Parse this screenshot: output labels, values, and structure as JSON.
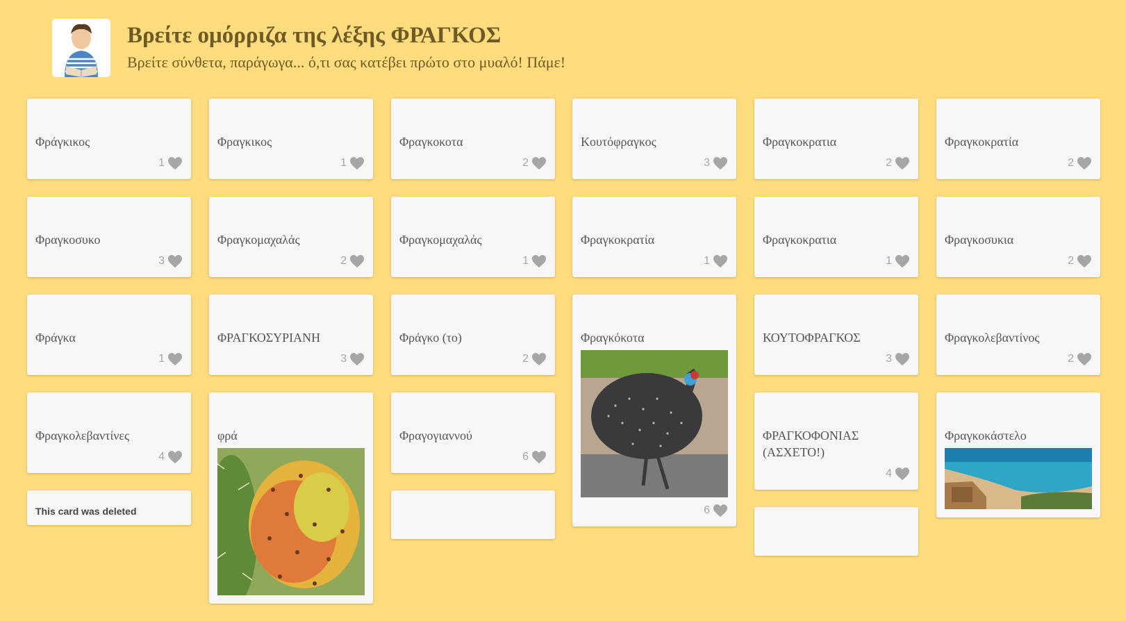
{
  "header": {
    "title": "Βρείτε ομόρριζα της λέξης ΦΡΑΓΚΟΣ",
    "subtitle": "Βρείτε σύνθετα, παράγωγα... ό,τι σας κατέβει πρώτο στο μυαλό! Πάμε!"
  },
  "columns": [
    [
      {
        "word": "Φράγκικος",
        "likes": "1"
      },
      {
        "word": "Φραγκοσυκο",
        "likes": "3"
      },
      {
        "word": "Φράγκα",
        "likes": "1"
      },
      {
        "word": "Φραγκολεβαντίνες",
        "likes": "4"
      },
      {
        "deleted": "This card was deleted"
      }
    ],
    [
      {
        "word": "Φραγκικος",
        "likes": "1"
      },
      {
        "word": "Φραγκομαχαλάς",
        "likes": "2"
      },
      {
        "word": "ΦΡΑΓΚΟΣΥΡΙΑΝΗ",
        "likes": "3"
      },
      {
        "word": "φρά",
        "image": "prickly-pear-image"
      }
    ],
    [
      {
        "word": "Φραγκοκοτα",
        "likes": "2"
      },
      {
        "word": "Φραγκομαχαλάς",
        "likes": "1"
      },
      {
        "word": "Φράγκο (το)",
        "likes": "2"
      },
      {
        "word": "Φραγογιαννού",
        "likes": "6"
      },
      {
        "blank": true
      }
    ],
    [
      {
        "word": "Κουτόφραγκος",
        "likes": "3"
      },
      {
        "word": "Φραγκοκρατία",
        "likes": "1"
      },
      {
        "word": "Φραγκόκοτα",
        "likes": "6",
        "image": "guinea-fowl-image"
      }
    ],
    [
      {
        "word": "Φραγκοκρατια",
        "likes": "2"
      },
      {
        "word": "Φραγκοκρατια",
        "likes": "1"
      },
      {
        "word": "ΚΟΥΤΟΦΡΑΓΚΟΣ",
        "likes": "3"
      },
      {
        "word": "ΦΡΑΓΚΟΦΟΝΙΑΣ (ΑΣΧΕΤΟ!)",
        "likes": "4"
      },
      {
        "blank": true
      }
    ],
    [
      {
        "word": "Φραγκοκρατία",
        "likes": "2"
      },
      {
        "word": "Φραγκοσυκια",
        "likes": "2"
      },
      {
        "word": "Φραγκολεβαντίνος",
        "likes": "2"
      },
      {
        "word": "Φραγκοκάστελο",
        "image": "beach-fortress-image"
      }
    ]
  ],
  "colors": {
    "background": "#ffdc7d",
    "card": "#f7f7f7",
    "heart": "#a6a6a6",
    "title": "#6e5a26"
  },
  "icons": {
    "like": "heart-icon"
  }
}
